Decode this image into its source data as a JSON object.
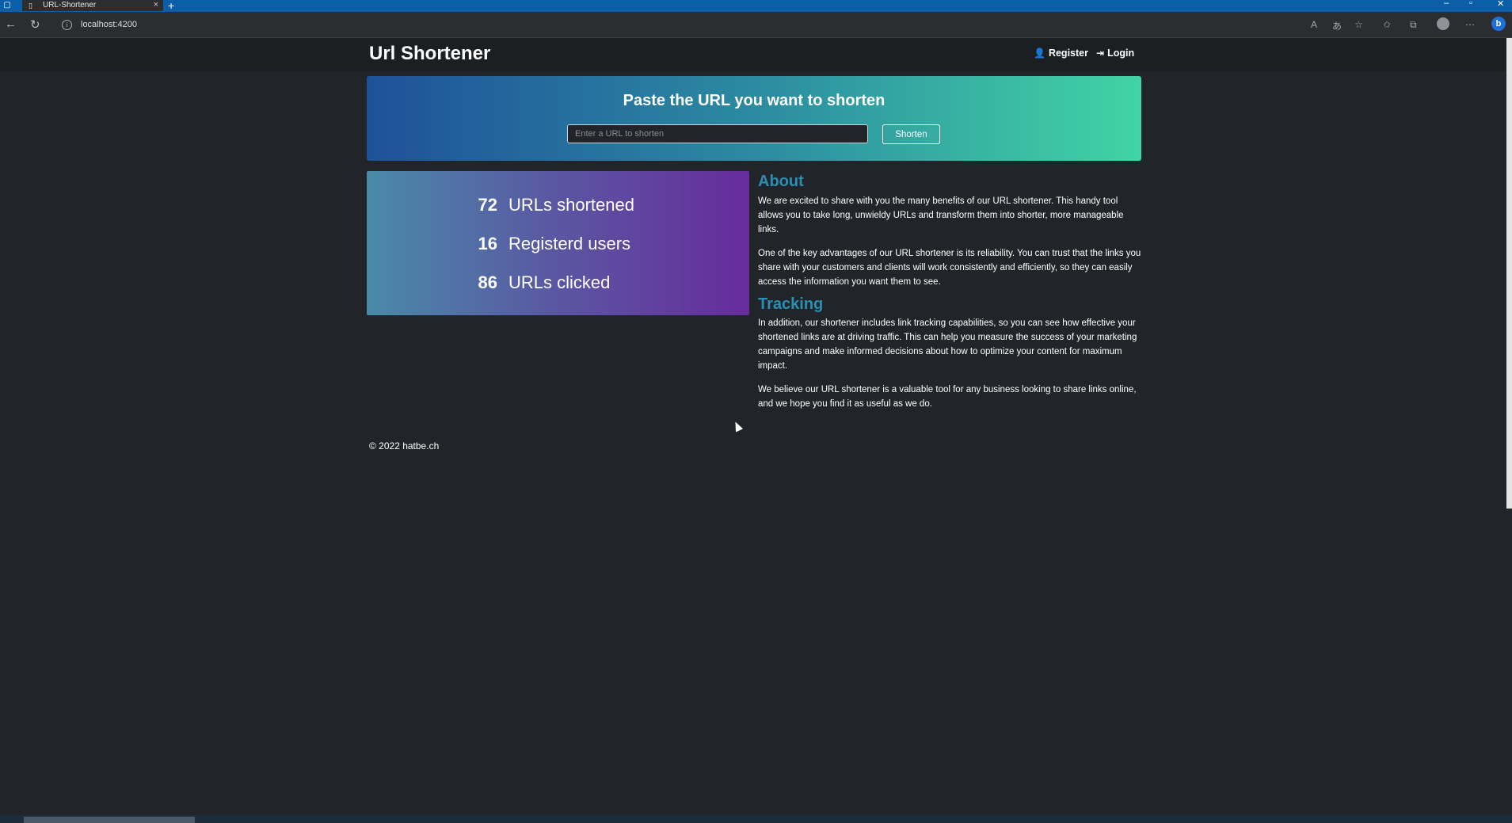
{
  "browser": {
    "tab_title": "URL-Shortener",
    "tab_close": "×",
    "new_tab": "+",
    "address_url": "localhost:4200",
    "back": "←",
    "reload": "↻"
  },
  "navbar": {
    "brand": "Url Shortener",
    "register_label": "Register",
    "login_label": "Login",
    "register_icon": "user-plus-icon",
    "login_icon": "sign-in-icon"
  },
  "hero": {
    "title": "Paste the URL you want to shorten",
    "input_placeholder": "Enter a URL to shorten",
    "input_value": "",
    "button_label": "Shorten"
  },
  "stats": [
    {
      "value": "72",
      "label": "URLs shortened"
    },
    {
      "value": "16",
      "label": "Registerd users"
    },
    {
      "value": "86",
      "label": "URLs clicked"
    }
  ],
  "about": {
    "title": "About",
    "p1": "We are excited to share with you the many benefits of our URL shortener. This handy tool allows you to take long, unwieldy URLs and transform them into shorter, more manageable links.",
    "p2": "One of the key advantages of our URL shortener is its reliability. You can trust that the links you share with your customers and clients will work consistently and efficiently, so they can easily access the information you want them to see."
  },
  "tracking": {
    "title": "Tracking",
    "p1": "In addition, our shortener includes link tracking capabilities, so you can see how effective your shortened links are at driving traffic. This can help you measure the success of your marketing campaigns and make informed decisions about how to optimize your content for maximum impact.",
    "p2": "We believe our URL shortener is a valuable tool for any business looking to share links online, and we hope you find it as useful as we do."
  },
  "footer": {
    "text": "© 2022 hatbe.ch"
  },
  "colors": {
    "page_bg": "#212529",
    "heading_accent": "#2b8fb3",
    "hero_gradient_start": "#1e5199",
    "hero_gradient_end": "#41d4a4",
    "stats_gradient_start": "#4a8aa8",
    "stats_gradient_end": "#662c9c"
  }
}
